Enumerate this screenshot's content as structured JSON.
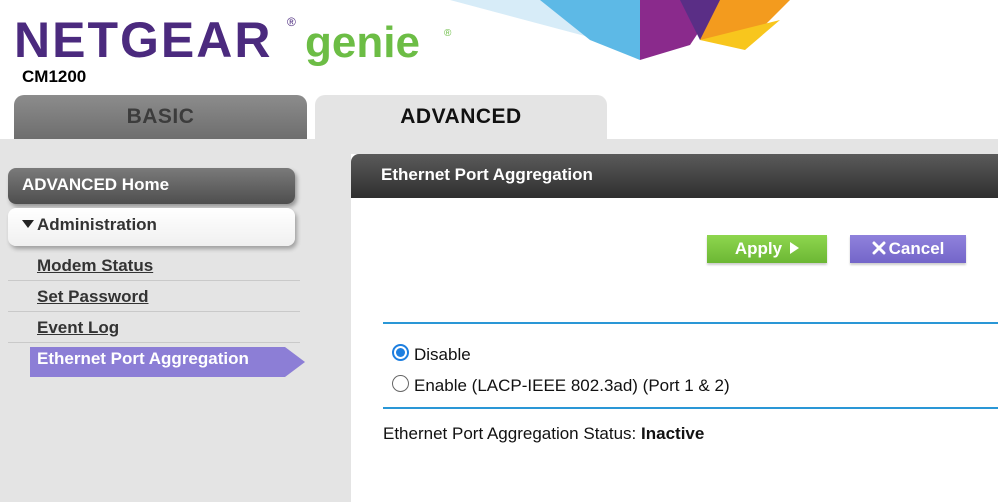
{
  "header": {
    "brand": "NETGEAR",
    "product": "genie",
    "model": "CM1200"
  },
  "colors": {
    "brand_purple": "#4b2a7e",
    "genie_green": "#6cbd45",
    "active_nav": "#8c7ed6",
    "apply_green": "#7cc640",
    "cancel_purple": "#7f72d0",
    "divider_blue": "#2a97d6"
  },
  "tabs": [
    {
      "label": "BASIC",
      "selected": false
    },
    {
      "label": "ADVANCED",
      "selected": true
    }
  ],
  "nav": {
    "home": "ADVANCED Home",
    "section": "Administration",
    "items": [
      {
        "label": "Modem Status"
      },
      {
        "label": "Set Password"
      },
      {
        "label": "Event Log"
      },
      {
        "label": "Ethernet Port Aggregation",
        "active": true
      }
    ]
  },
  "panel": {
    "title": "Ethernet Port Aggregation",
    "apply_label": "Apply",
    "cancel_label": "Cancel",
    "options": [
      {
        "label": "Disable",
        "checked": true
      },
      {
        "label": "Enable (LACP-IEEE 802.3ad) (Port 1 & 2)",
        "checked": false
      }
    ],
    "status_label": "Ethernet Port Aggregation Status:",
    "status_value": "Inactive"
  },
  "icons": {
    "cancel": "x-icon",
    "apply": "arrow-right-icon",
    "section": "triangle-down-icon"
  }
}
